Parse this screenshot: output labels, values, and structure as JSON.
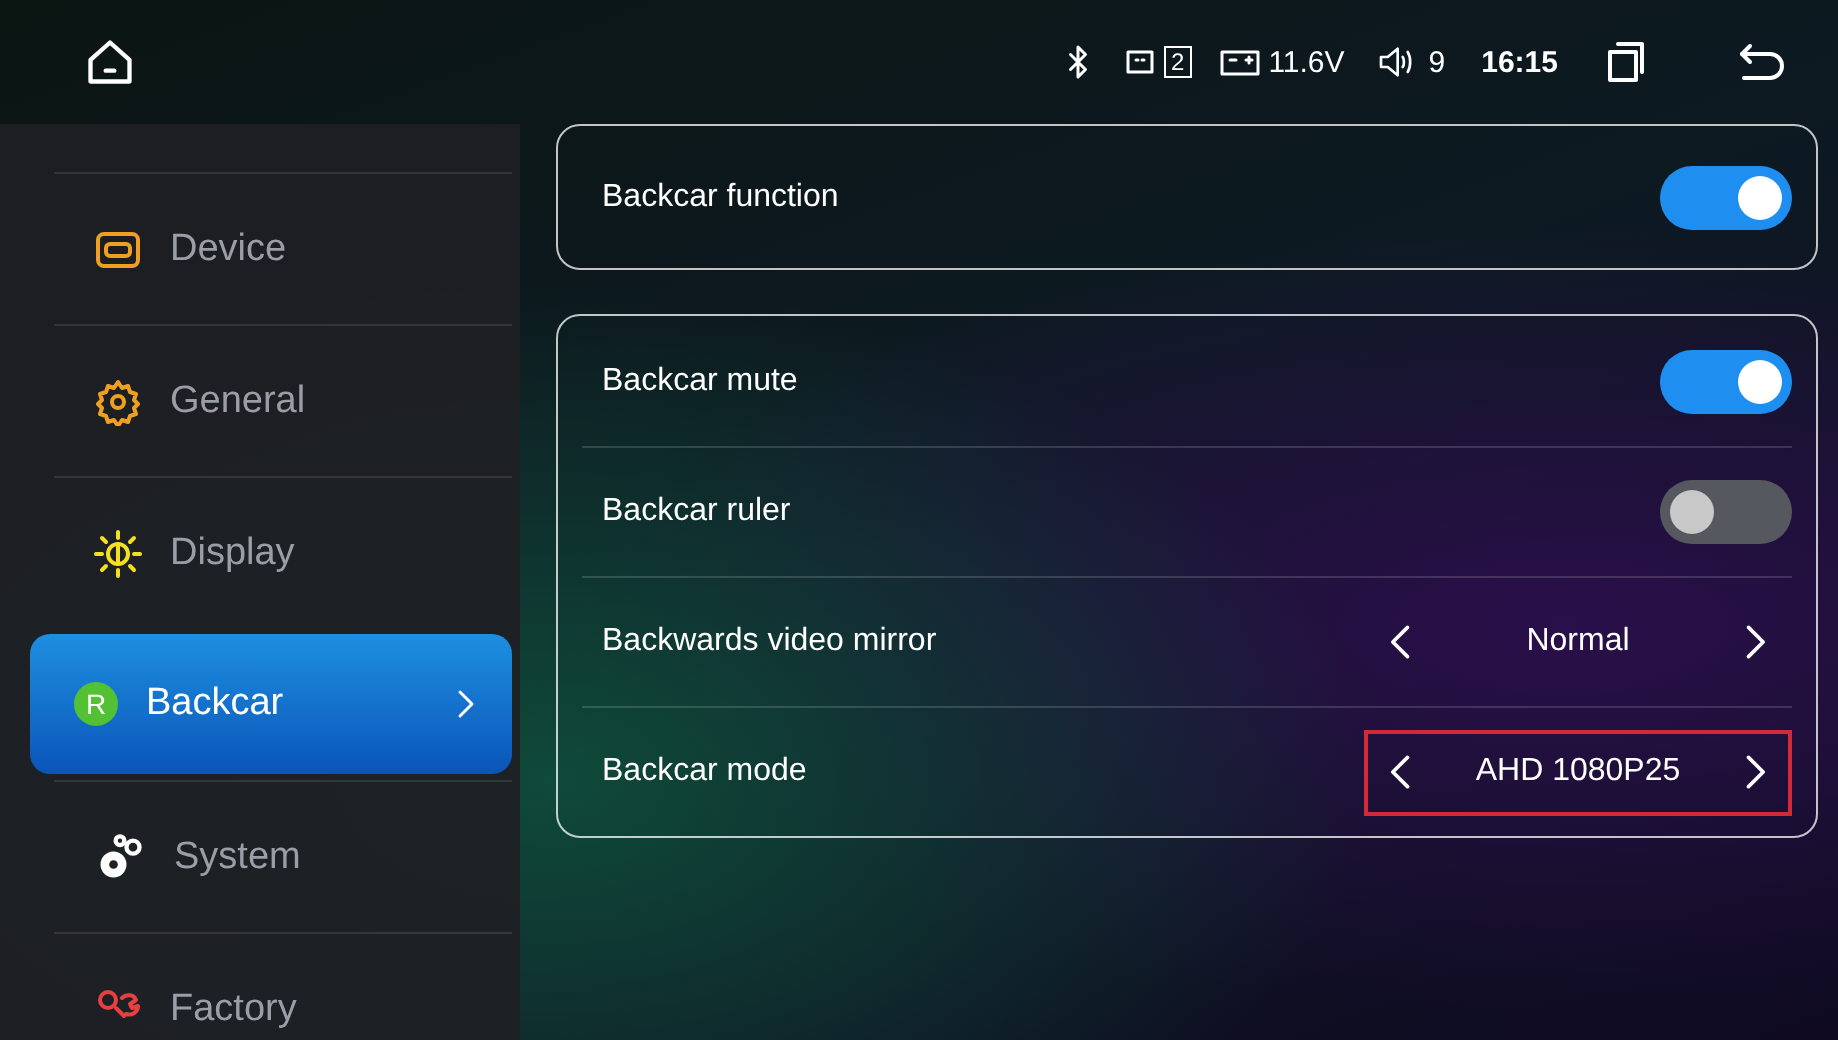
{
  "status_bar": {
    "usb_count": "2",
    "voltage": "11.6V",
    "volume": "9",
    "time": "16:15"
  },
  "sidebar": {
    "items": [
      {
        "label": "Device",
        "selected": false
      },
      {
        "label": "General",
        "selected": false
      },
      {
        "label": "Display",
        "selected": false
      },
      {
        "label": "Backcar",
        "badge": "R",
        "selected": true
      },
      {
        "label": "System",
        "selected": false
      },
      {
        "label": "Factory",
        "selected": false
      }
    ]
  },
  "groups": [
    {
      "rows": [
        {
          "kind": "toggle",
          "label": "Backcar function",
          "on": true
        }
      ]
    },
    {
      "rows": [
        {
          "kind": "toggle",
          "label": "Backcar mute",
          "on": true
        },
        {
          "kind": "toggle",
          "label": "Backcar ruler",
          "on": false
        },
        {
          "kind": "selector",
          "label": "Backwards video mirror",
          "value": "Normal",
          "highlighted": false
        },
        {
          "kind": "selector",
          "label": "Backcar mode",
          "value": "AHD 1080P25",
          "highlighted": true
        }
      ]
    }
  ]
}
